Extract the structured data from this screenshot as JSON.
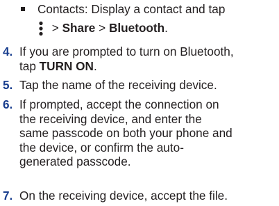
{
  "bullet_item": {
    "line1": "Contacts: Display a contact and tap",
    "menu_icon": "more-vert-icon",
    "sep1": " > ",
    "share": "Share",
    "sep2": " > ",
    "bluetooth": "Bluetooth",
    "end": "."
  },
  "steps": [
    {
      "number": "4.",
      "line1": "If you are prompted to turn on Bluetooth,",
      "line2_pre": "tap ",
      "line2_bold": "TURN ON",
      "line2_post": "."
    },
    {
      "number": "5.",
      "line1": "Tap the name of the receiving device."
    },
    {
      "number": "6.",
      "line1": "If prompted, accept the connection on",
      "line2": "the receiving device, and enter the",
      "line3": "same passcode on both your phone and",
      "line4": "the device, or confirm the auto-",
      "line5": "generated passcode."
    },
    {
      "number": "7.",
      "line1": "On the receiving device, accept the file."
    }
  ],
  "colors": {
    "text": "#231f20",
    "step_number": "#1a3f8f"
  }
}
